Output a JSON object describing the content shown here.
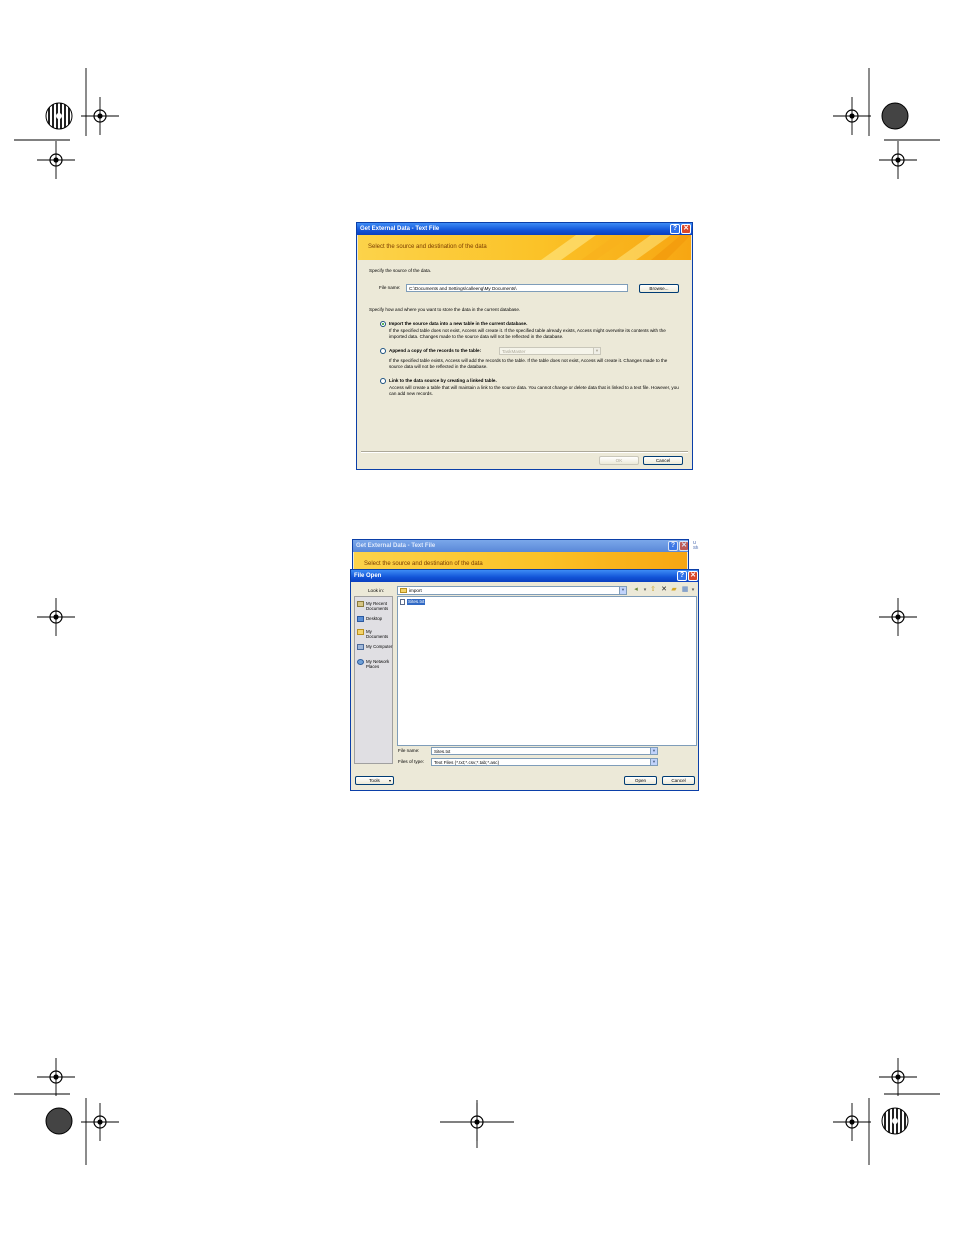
{
  "import_dialog": {
    "title": "Get External Data - Text File",
    "banner": "Select the source and destination of the data",
    "source_prompt": "Specify the source of the data.",
    "file_name_label": "File name:",
    "file_name_value": "C:\\Documents and Settings\\calleeng\\My Documents\\",
    "browse_button": "Browse...",
    "store_prompt": "Specify how and where you want to store the data in the current database.",
    "options": [
      {
        "label": "Import the source data into a new table in the current database.",
        "description": "If the specified table does not exist, Access will create it. If the specified table already exists, Access might overwrite its contents with the imported data. Changes made to the source data will not be reflected in the database.",
        "selected": true
      },
      {
        "label": "Append a copy of the records to the table:",
        "description": "If the specified table exists, Access will add the records to the table. If the table does not exist, Access will create it. Changes made to the source data will not be reflected in the database.",
        "selected": false,
        "combo_value": "TaskMaster"
      },
      {
        "label": "Link to the data source by creating a linked table.",
        "description": "Access will create a table that will maintain a link to the source data. You cannot change or delete data that is linked to a text file. However, you can add new records.",
        "selected": false
      }
    ],
    "ok_button": "OK",
    "cancel_button": "Cancel"
  },
  "file_open_dialog": {
    "background_title": "Get External Data - Text File",
    "background_banner": "Select the source and destination of the data",
    "background_side_text": [
      "U",
      "Sh"
    ],
    "title": "File Open",
    "look_in_label": "Look in:",
    "look_in_value": "import",
    "places": [
      "My Recent Documents",
      "Desktop",
      "My Documents",
      "My Computer",
      "My Network Places"
    ],
    "files": [
      "Sites.txt"
    ],
    "file_name_label": "File name:",
    "file_name_value": "Sites.txt",
    "file_type_label": "Files of type:",
    "file_type_value": "Text Files (*.txt;*.csv;*.tab;*.asc)",
    "tools_button": "Tools",
    "open_button": "Open",
    "cancel_button": "Cancel"
  },
  "colors": {
    "title_bar": "#1254d8",
    "banner": "#fbc227",
    "dialog_face": "#ece9d8",
    "close_button": "#d9472b"
  }
}
